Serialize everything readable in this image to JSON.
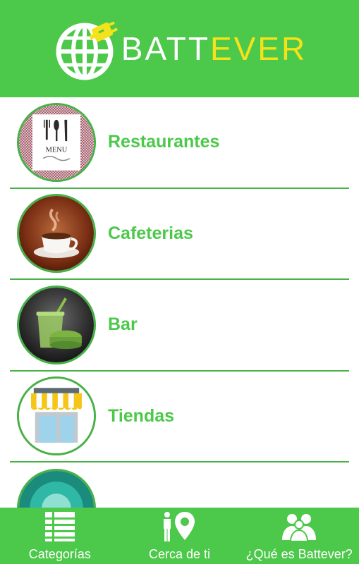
{
  "header": {
    "brand_part1": "BATT",
    "brand_part2": "EVER",
    "logo_icon": "globe-plug-icon"
  },
  "colors": {
    "primary_green": "#4cc84a",
    "divider_green": "#46b146",
    "brand_yellow": "#f4e21a"
  },
  "categories": [
    {
      "label": "Restaurantes",
      "icon": "menu-cutlery-icon"
    },
    {
      "label": "Cafeterias",
      "icon": "coffee-cup-icon"
    },
    {
      "label": "Bar",
      "icon": "drink-burger-icon"
    },
    {
      "label": "Tiendas",
      "icon": "storefront-icon"
    },
    {
      "label": "",
      "icon": "category-icon-partial"
    }
  ],
  "menu_thumb_text": "MENU",
  "tabs": [
    {
      "label": "Categorías",
      "icon": "list-icon"
    },
    {
      "label": "Cerca de ti",
      "icon": "person-location-icon"
    },
    {
      "label": "¿Qué es Battever?",
      "icon": "group-icon"
    }
  ]
}
